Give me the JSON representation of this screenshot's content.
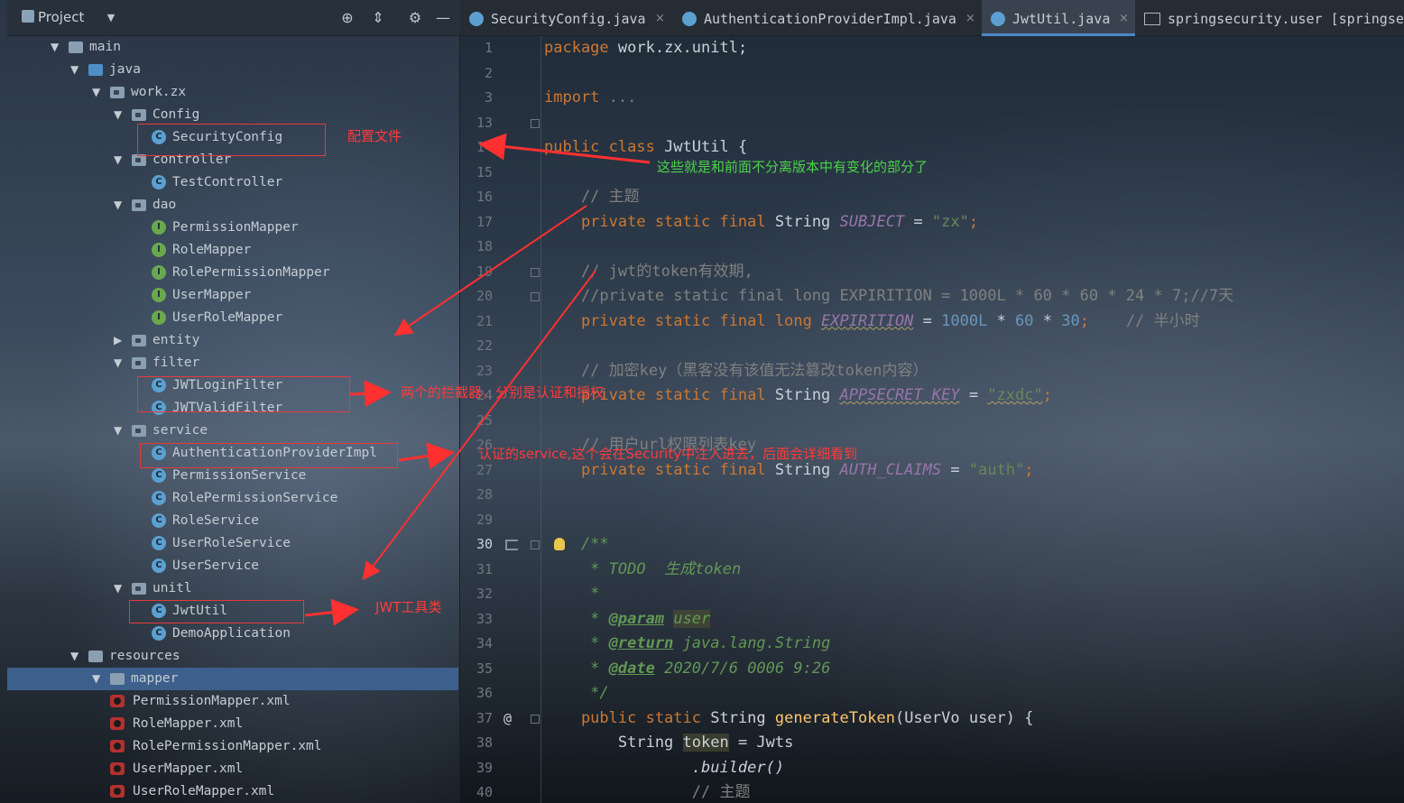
{
  "project_panel": {
    "title": "Project",
    "header_icons": [
      "crosshair-icon",
      "collapse-icon",
      "gear-icon",
      "minimize-icon"
    ]
  },
  "tree": [
    {
      "label": "main",
      "type": "folder"
    },
    {
      "label": "java",
      "type": "folder-blue"
    },
    {
      "label": "work.zx",
      "type": "package"
    },
    {
      "label": "Config",
      "type": "package"
    },
    {
      "label": "SecurityConfig",
      "type": "class"
    },
    {
      "label": "controller",
      "type": "package"
    },
    {
      "label": "TestController",
      "type": "class"
    },
    {
      "label": "dao",
      "type": "package"
    },
    {
      "label": "PermissionMapper",
      "type": "interface"
    },
    {
      "label": "RoleMapper",
      "type": "interface"
    },
    {
      "label": "RolePermissionMapper",
      "type": "interface"
    },
    {
      "label": "UserMapper",
      "type": "interface"
    },
    {
      "label": "UserRoleMapper",
      "type": "interface"
    },
    {
      "label": "entity",
      "type": "package"
    },
    {
      "label": "filter",
      "type": "package"
    },
    {
      "label": "JWTLoginFilter",
      "type": "class"
    },
    {
      "label": "JWTValidFilter",
      "type": "class"
    },
    {
      "label": "service",
      "type": "package"
    },
    {
      "label": "AuthenticationProviderImpl",
      "type": "class"
    },
    {
      "label": "PermissionService",
      "type": "class"
    },
    {
      "label": "RolePermissionService",
      "type": "class"
    },
    {
      "label": "RoleService",
      "type": "class"
    },
    {
      "label": "UserRoleService",
      "type": "class"
    },
    {
      "label": "UserService",
      "type": "class"
    },
    {
      "label": "unitl",
      "type": "package"
    },
    {
      "label": "JwtUtil",
      "type": "class"
    },
    {
      "label": "DemoApplication",
      "type": "class"
    },
    {
      "label": "resources",
      "type": "folder"
    },
    {
      "label": "mapper",
      "type": "folder"
    },
    {
      "label": "PermissionMapper.xml",
      "type": "xml"
    },
    {
      "label": "RoleMapper.xml",
      "type": "xml"
    },
    {
      "label": "RolePermissionMapper.xml",
      "type": "xml"
    },
    {
      "label": "UserMapper.xml",
      "type": "xml"
    },
    {
      "label": "UserRoleMapper.xml",
      "type": "xml"
    }
  ],
  "annotations": {
    "config": "配置文件",
    "filters": "两个的拦截器，分别是认证和授权",
    "service": "认证的service,这个会在Security中注入进去，后面会详细看到",
    "jwt": "JWT工具类",
    "changes": "这些就是和前面不分离版本中有变化的部分了"
  },
  "tabs": [
    {
      "label": "SecurityConfig.java",
      "close": "×"
    },
    {
      "label": "AuthenticationProviderImpl.java",
      "close": "×"
    },
    {
      "label": "JwtUtil.java",
      "close": "×"
    },
    {
      "label": "springsecurity.user [springsec"
    }
  ],
  "line_numbers": [
    "1",
    "2",
    "3",
    "13",
    "14",
    "15",
    "16",
    "17",
    "18",
    "19",
    "20",
    "21",
    "22",
    "23",
    "24",
    "25",
    "26",
    "27",
    "28",
    "29",
    "30",
    "31",
    "32",
    "33",
    "34",
    "35",
    "36",
    "37",
    "38",
    "39",
    "40"
  ],
  "code": {
    "l1_kw": "package",
    "l1_rest": " work.zx.unitl;",
    "l3_kw": "import",
    "l3_rest": " ...",
    "l14_kw": "public class",
    "l14_rest": " JwtUtil {",
    "l16": "    // 主题",
    "l17_kw": "    private static final",
    "l17_type": " String ",
    "l17_name": "SUBJECT",
    "l17_eq": " = ",
    "l17_val": "\"zx\"",
    "l17_end": ";",
    "l19": "    // jwt的token有效期,",
    "l20": "    //private static final long EXPIRITION = 1000L * 60 * 60 * 24 * 7;//7天",
    "l21_kw": "    private static final long",
    "l21_name": "EXPIRITION",
    "l21_eq": " = ",
    "l21_val": "1000L",
    "l21_op1": " * ",
    "l21_v2": "60",
    "l21_op2": " * ",
    "l21_v3": "30",
    "l21_end": ";",
    "l21_cmt": "    // 半小时",
    "l23": "    // 加密key（黑客没有该值无法篡改token内容）",
    "l24_kw": "    private static final",
    "l24_type": " String ",
    "l24_name": "APPSECRET_KEY",
    "l24_eq": " = ",
    "l24_val": "\"zxdc\"",
    "l24_end": ";",
    "l26": "    // 用户url权限列表key",
    "l27_kw": "    private static final",
    "l27_type": " String ",
    "l27_name": "AUTH_CLAIMS",
    "l27_eq": " = ",
    "l27_val": "\"auth\"",
    "l27_end": ";",
    "l30": "    /**",
    "l31_a": "     * ",
    "l31_b": "TODO",
    "l31_c": "  生成token",
    "l32": "     *",
    "l33_a": "     * ",
    "l33_tag": "@param",
    "l33_b": " ",
    "l33_user": "user",
    "l34_a": "     * ",
    "l34_tag": "@return",
    "l34_b": " java.lang.String",
    "l35_a": "     * ",
    "l35_tag": "@date",
    "l35_b": " 2020/7/6 0006 9:26",
    "l36": "     */",
    "l37_kw": "    public static",
    "l37_type": " String ",
    "l37_fn": "generateToken",
    "l37_rest": "(UserVo user) {",
    "l38_a": "        String ",
    "l38_tok": "token",
    "l38_b": " = Jwts",
    "l39": "                .builder()",
    "l40": "                // 主题"
  },
  "gutter_marker": "@",
  "colors": {
    "annotation_red": "#e83a3a",
    "annotation_green": "#4cd14c",
    "selection": "#3d5f8c"
  }
}
